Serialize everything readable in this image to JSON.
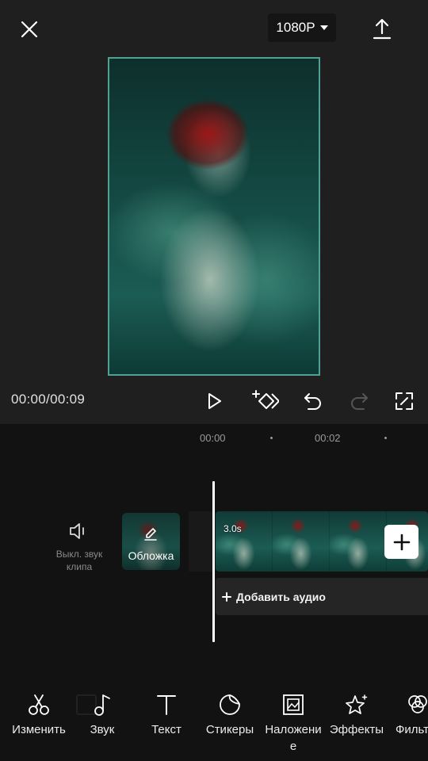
{
  "header": {
    "resolution_label": "1080P",
    "close_icon": "close-icon",
    "export_icon": "export-upload-icon"
  },
  "player": {
    "time": "00:00/00:09",
    "controls": [
      "play-icon",
      "keyframe-icon",
      "undo-icon",
      "redo-icon",
      "fullscreen-icon"
    ]
  },
  "timeline": {
    "ruler": [
      "00:00",
      "00:02"
    ],
    "mute": {
      "label_line1": "Выкл. звук",
      "label_line2": "клипа"
    },
    "cover": {
      "label": "Обложка"
    },
    "clip": {
      "duration": "3.0s",
      "frame_count": 4
    },
    "add_audio_label": "Добавить аудио"
  },
  "toolbar": {
    "items": [
      {
        "label": "Изменить",
        "icon": "scissors-icon"
      },
      {
        "label": "Звук",
        "icon": "music-note-icon"
      },
      {
        "label": "Текст",
        "icon": "text-icon"
      },
      {
        "label": "Стикеры",
        "icon": "sticker-icon"
      },
      {
        "label_line1": "Наложени",
        "label_line2": "е",
        "icon": "overlay-icon"
      },
      {
        "label": "Эффекты",
        "icon": "effects-star-icon"
      },
      {
        "label": "Фильт",
        "icon": "filters-icon"
      }
    ]
  },
  "colors": {
    "background": "#121212",
    "top_panel": "#1f1f1f",
    "preview_border": "#4fa192",
    "accent_white": "#ffffff"
  }
}
